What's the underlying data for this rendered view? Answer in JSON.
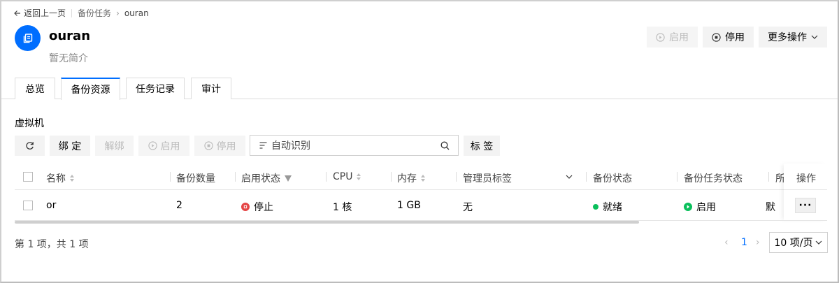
{
  "breadcrumb": {
    "back": "返回上一页",
    "parent": "备份任务",
    "current": "ouran"
  },
  "header": {
    "title": "ouran",
    "description": "暂无简介",
    "buttons": {
      "enable": "启用",
      "disable": "停用",
      "more": "更多操作"
    }
  },
  "tabs": [
    {
      "label": "总览"
    },
    {
      "label": "备份资源",
      "active": true
    },
    {
      "label": "任务记录"
    },
    {
      "label": "审计"
    }
  ],
  "section": {
    "title": "虚拟机"
  },
  "toolbar": {
    "bind": "绑 定",
    "unbind": "解绑",
    "enable": "启用",
    "disable": "停用",
    "search_placeholder": "自动识别",
    "tag": "标 签"
  },
  "table": {
    "headers": {
      "name": "名称",
      "backup_count": "备份数量",
      "enable_status": "启用状态",
      "cpu": "CPU",
      "memory": "内存",
      "admin_tag": "管理员标签",
      "backup_status": "备份状态",
      "task_status": "备份任务状态",
      "owner": "所",
      "ops": "操作"
    },
    "rows": [
      {
        "name": "or",
        "backup_count": "2",
        "enable_status": "停止",
        "cpu": "1 核",
        "memory": "1 GB",
        "admin_tag": "无",
        "backup_status": "就绪",
        "task_status": "启用",
        "owner": "默"
      }
    ]
  },
  "footer": {
    "summary": "第 1 项，共 1 项",
    "page": "1",
    "page_size": "10 项/页"
  },
  "colors": {
    "accent": "#006eff",
    "success": "#0abf5b",
    "danger": "#e54545"
  }
}
